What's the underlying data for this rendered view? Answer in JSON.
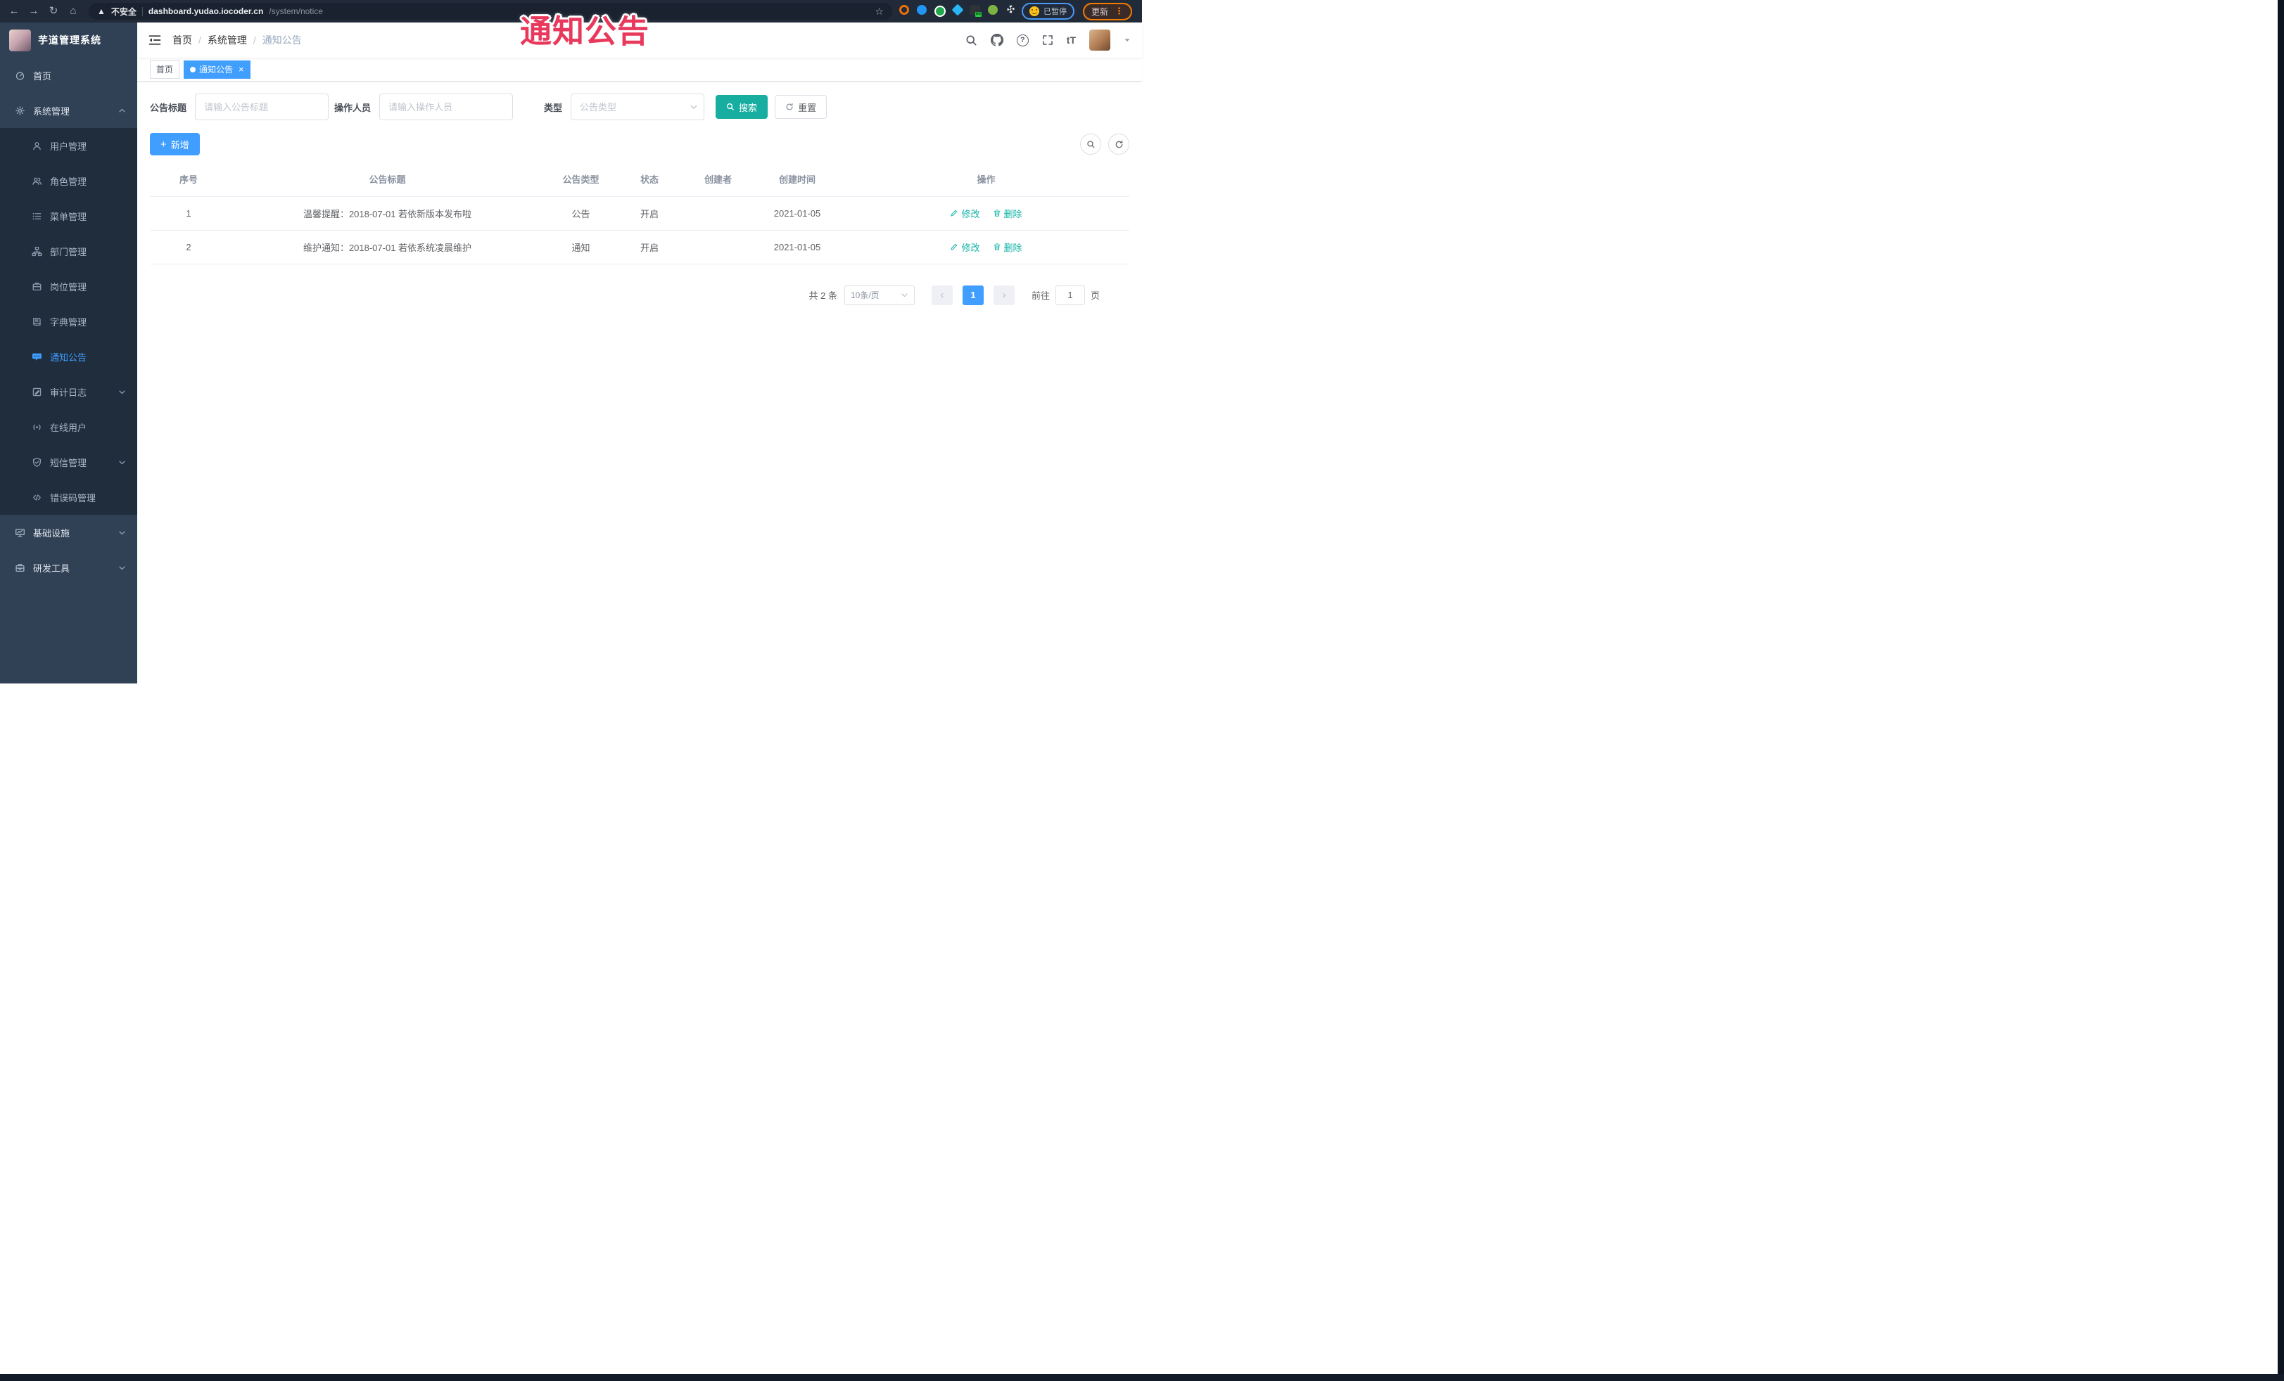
{
  "browser": {
    "security_label": "不安全",
    "url_host": "dashboard.yudao.iocoder.cn",
    "url_path": "/system/notice",
    "paused_label": "已暂停",
    "update_label": "更新",
    "nav_icons": [
      "back-icon",
      "forward-icon",
      "reload-icon",
      "home-icon"
    ],
    "extension_icons": [
      "ext-orange-ring-icon",
      "ext-blue-drop-icon",
      "ext-green-circle-icon",
      "ext-blue-diamond-icon",
      "ext-dark-on-icon",
      "ext-green-sprout-icon",
      "extensions-puzzle-icon"
    ]
  },
  "annotation": {
    "text": "通知公告",
    "color": "#e8395c"
  },
  "sidebar": {
    "title": "芋道管理系统",
    "items": [
      {
        "label": "首页",
        "icon": "dashboard-icon",
        "type": "top",
        "active": false,
        "arrow": ""
      },
      {
        "label": "系统管理",
        "icon": "gear-icon",
        "type": "top",
        "active": false,
        "arrow": "up"
      },
      {
        "label": "用户管理",
        "icon": "user-icon",
        "type": "sub",
        "active": false,
        "arrow": ""
      },
      {
        "label": "角色管理",
        "icon": "users-icon",
        "type": "sub",
        "active": false,
        "arrow": ""
      },
      {
        "label": "菜单管理",
        "icon": "menu-list-icon",
        "type": "sub",
        "active": false,
        "arrow": ""
      },
      {
        "label": "部门管理",
        "icon": "org-tree-icon",
        "type": "sub",
        "active": false,
        "arrow": ""
      },
      {
        "label": "岗位管理",
        "icon": "badge-icon",
        "type": "sub",
        "active": false,
        "arrow": ""
      },
      {
        "label": "字典管理",
        "icon": "book-icon",
        "type": "sub",
        "active": false,
        "arrow": ""
      },
      {
        "label": "通知公告",
        "icon": "notice-icon",
        "type": "sub",
        "active": true,
        "arrow": ""
      },
      {
        "label": "审计日志",
        "icon": "log-icon",
        "type": "sub",
        "active": false,
        "arrow": "down"
      },
      {
        "label": "在线用户",
        "icon": "online-user-icon",
        "type": "sub",
        "active": false,
        "arrow": ""
      },
      {
        "label": "短信管理",
        "icon": "sms-shield-icon",
        "type": "sub",
        "active": false,
        "arrow": "down"
      },
      {
        "label": "错误码管理",
        "icon": "code-icon",
        "type": "sub",
        "active": false,
        "arrow": ""
      },
      {
        "label": "基础设施",
        "icon": "infrastructure-icon",
        "type": "top",
        "active": false,
        "arrow": "down"
      },
      {
        "label": "研发工具",
        "icon": "devtools-icon",
        "type": "top",
        "active": false,
        "arrow": "down"
      }
    ]
  },
  "navbar": {
    "breadcrumb": [
      "首页",
      "系统管理",
      "通知公告"
    ],
    "right_icons": [
      "search-icon",
      "github-icon",
      "help-icon",
      "fullscreen-icon",
      "font-size-icon"
    ]
  },
  "tabs": [
    {
      "label": "首页",
      "active": false,
      "closable": false
    },
    {
      "label": "通知公告",
      "active": true,
      "closable": true
    }
  ],
  "filters": {
    "title_label": "公告标题",
    "title_placeholder": "请输入公告标题",
    "operator_label": "操作人员",
    "operator_placeholder": "请输入操作人员",
    "type_label": "类型",
    "type_placeholder": "公告类型",
    "search_label": "搜索",
    "reset_label": "重置"
  },
  "toolbar": {
    "add_label": "新增"
  },
  "table": {
    "headers": [
      "序号",
      "公告标题",
      "公告类型",
      "状态",
      "创建者",
      "创建时间",
      "操作"
    ],
    "rows": [
      {
        "index": "1",
        "title": "温馨提醒：2018-07-01 若依新版本发布啦",
        "type": "公告",
        "status": "开启",
        "creator": "",
        "created_at": "2021-01-05"
      },
      {
        "index": "2",
        "title": "维护通知：2018-07-01 若依系统凌晨维护",
        "type": "通知",
        "status": "开启",
        "creator": "",
        "created_at": "2021-01-05"
      }
    ],
    "edit_label": "修改",
    "delete_label": "删除"
  },
  "pagination": {
    "total_text": "共 2 条",
    "page_size_text": "10条/页",
    "current_page": "1",
    "goto_label": "前往",
    "goto_value": "1",
    "page_label": "页"
  },
  "colors": {
    "accent_blue": "#409eff",
    "teal_primary": "#17ada0",
    "op_link_teal": "#12b3a6",
    "annotation_red": "#e8395c",
    "sidebar_bg": "#304156",
    "submenu_bg": "#1f2d3d",
    "browser_bar_bg": "#212a38",
    "update_orange": "#f57c00",
    "paused_border_blue": "#4a9af5"
  }
}
